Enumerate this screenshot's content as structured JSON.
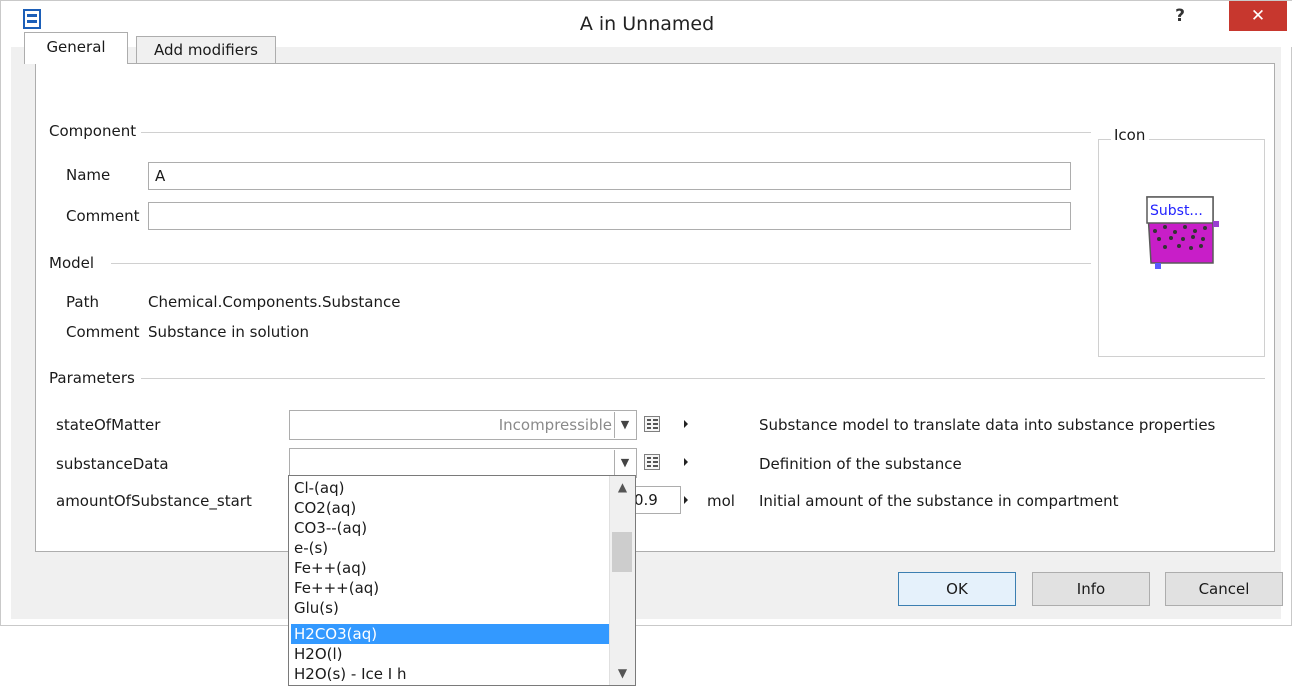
{
  "window": {
    "title": "A in Unnamed",
    "help_label": "?",
    "close_label": "✕"
  },
  "tabs": [
    {
      "label": "General"
    },
    {
      "label": "Add modifiers"
    }
  ],
  "component": {
    "group_label": "Component",
    "name_label": "Name",
    "name_value": "A",
    "comment_label": "Comment",
    "comment_value": ""
  },
  "icon_box": {
    "group_label": "Icon",
    "icon_text": "Subst...",
    "icon_name": "substance-beaker-icon"
  },
  "model": {
    "group_label": "Model",
    "path_label": "Path",
    "path_value": "Chemical.Components.Substance",
    "comment_label": "Comment",
    "comment_value": "Substance in solution"
  },
  "parameters": {
    "group_label": "Parameters",
    "rows": [
      {
        "name": "stateOfMatter",
        "value": "Incompressible",
        "unit": "",
        "description": "Substance model to translate data into substance properties"
      },
      {
        "name": "substanceData",
        "value": "",
        "unit": "",
        "description": "Definition of the substance"
      },
      {
        "name": "amountOfSubstance_start",
        "value": "0.9",
        "unit": "mol",
        "description": "Initial amount of the substance in compartment"
      }
    ]
  },
  "dropdown": {
    "options": [
      "Cl-(aq)",
      "CO2(aq)",
      "CO3--(aq)",
      "e-(s)",
      "Fe++(aq)",
      "Fe+++(aq)",
      "Glu(s)",
      "H2CO3(aq)",
      "H2O(l)",
      "H2O(s) - Ice I h"
    ],
    "selected": "H2CO3(aq)"
  },
  "buttons": {
    "ok": "OK",
    "info": "Info",
    "cancel": "Cancel"
  },
  "colors": {
    "selection": "#3399ff",
    "close": "#c7372e",
    "icon_fill": "#c81ec8"
  }
}
